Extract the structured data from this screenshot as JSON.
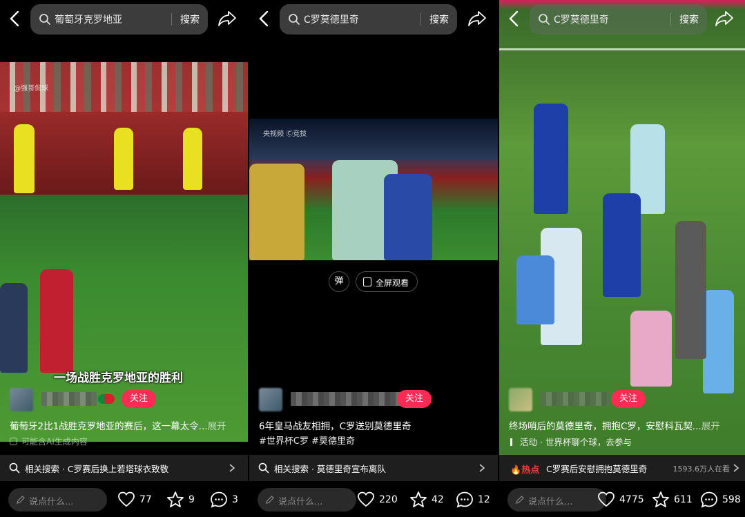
{
  "panels": [
    {
      "search": {
        "query": "葡萄牙克罗地亚",
        "button": "搜索"
      },
      "watermark": "@强哥侃球",
      "caption": "一场战胜克罗地亚的胜利",
      "follow": "关注",
      "description": "葡萄牙2比1战胜克罗地亚的赛后，这一幕太令...",
      "more": "展开",
      "ai_note": "可能含AI生成内容",
      "related_label": "相关搜索 · C罗赛后换上若塔球衣致敬",
      "comment_placeholder": "说点什么...",
      "likes": "77",
      "favorites": "9",
      "comments": "3"
    },
    {
      "search": {
        "query": "C罗莫德里奇",
        "button": "搜索"
      },
      "watermark": "央视频 Ⓒ竞技",
      "danmu": "弹",
      "fullscreen": "全屏观看",
      "follow": "关注",
      "description": "6年皇马战友相拥，C罗送别莫德里奇",
      "hashtags": "#世界杯C罗 #莫德里奇",
      "related_label": "相关搜索 · 莫德里奇宣布离队",
      "comment_placeholder": "说点什么...",
      "likes": "220",
      "favorites": "42",
      "comments": "12"
    },
    {
      "search": {
        "query": "C罗莫德里奇",
        "button": "搜索"
      },
      "follow": "关注",
      "description": "终场哨后的莫德里奇，拥抱C罗，安慰科瓦契...",
      "more": "展开",
      "activity": "活动 · 世界杯聊个球，去参与",
      "hot_tag": "热点",
      "related_label": "C罗赛后安慰拥抱莫德里奇",
      "watching": "1593.6万人在看",
      "comment_placeholder": "说点什么...",
      "likes": "4775",
      "favorites": "611",
      "comments": "598"
    }
  ],
  "colors": {
    "follow": "#fe2c55",
    "hot": "#ff3b3b",
    "related_bg": "#1e1e1e"
  },
  "icons": [
    "back-arrow-icon",
    "search-icon",
    "share-icon",
    "heart-icon",
    "star-icon",
    "comment-icon",
    "pen-icon",
    "chevron-right-icon",
    "fire-icon"
  ]
}
